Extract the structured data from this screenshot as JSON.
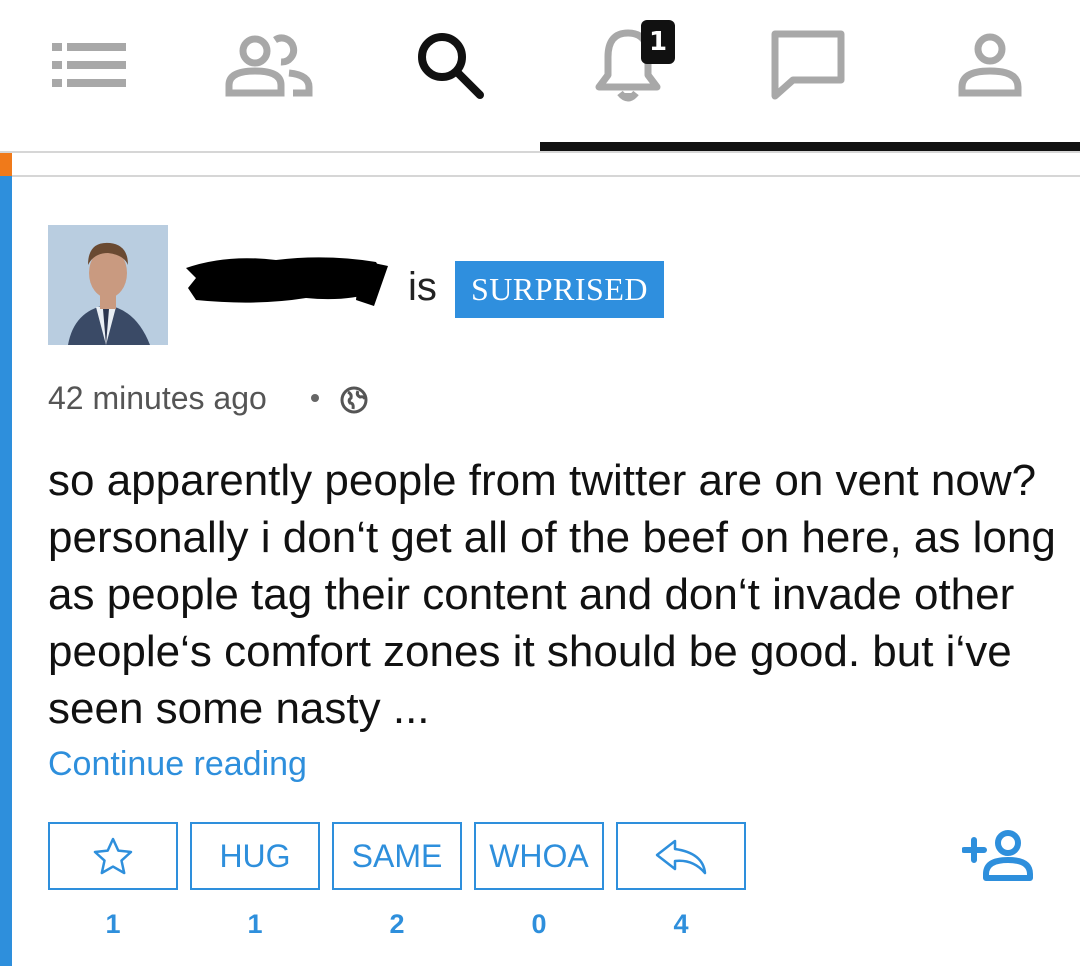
{
  "nav": {
    "items": [
      {
        "name": "menu",
        "icon": "menu-icon"
      },
      {
        "name": "people",
        "icon": "people-icon"
      },
      {
        "name": "search",
        "icon": "search-icon"
      },
      {
        "name": "notifications",
        "icon": "bell-icon",
        "badge": "1"
      },
      {
        "name": "messages",
        "icon": "chat-icon"
      },
      {
        "name": "profile",
        "icon": "user-icon"
      }
    ],
    "active": "search"
  },
  "post": {
    "verb": "is",
    "mood": "SURPRISED",
    "timestamp": "42 minutes ago",
    "visibility_icon": "globe-icon",
    "body": "so apparently people from twitter are on vent now? personally i don‘t get all of the beef on here, as long as people tag their content and don‘t invade other people‘s comfort zones it should be good. but i‘ve seen some nasty ...",
    "continue_label": "Continue reading"
  },
  "reactions": [
    {
      "label": "",
      "icon": "star-icon",
      "count": "1"
    },
    {
      "label": "HUG",
      "count": "1"
    },
    {
      "label": "SAME",
      "count": "2"
    },
    {
      "label": "WHOA",
      "count": "0"
    },
    {
      "label": "",
      "icon": "reply-icon",
      "count": "4"
    }
  ],
  "add_friend_icon": "add-friend-icon",
  "colors": {
    "accent": "#2e8fdc",
    "nav_icon": "#a8a8a8",
    "active": "#111111",
    "orange": "#f07a1a"
  }
}
